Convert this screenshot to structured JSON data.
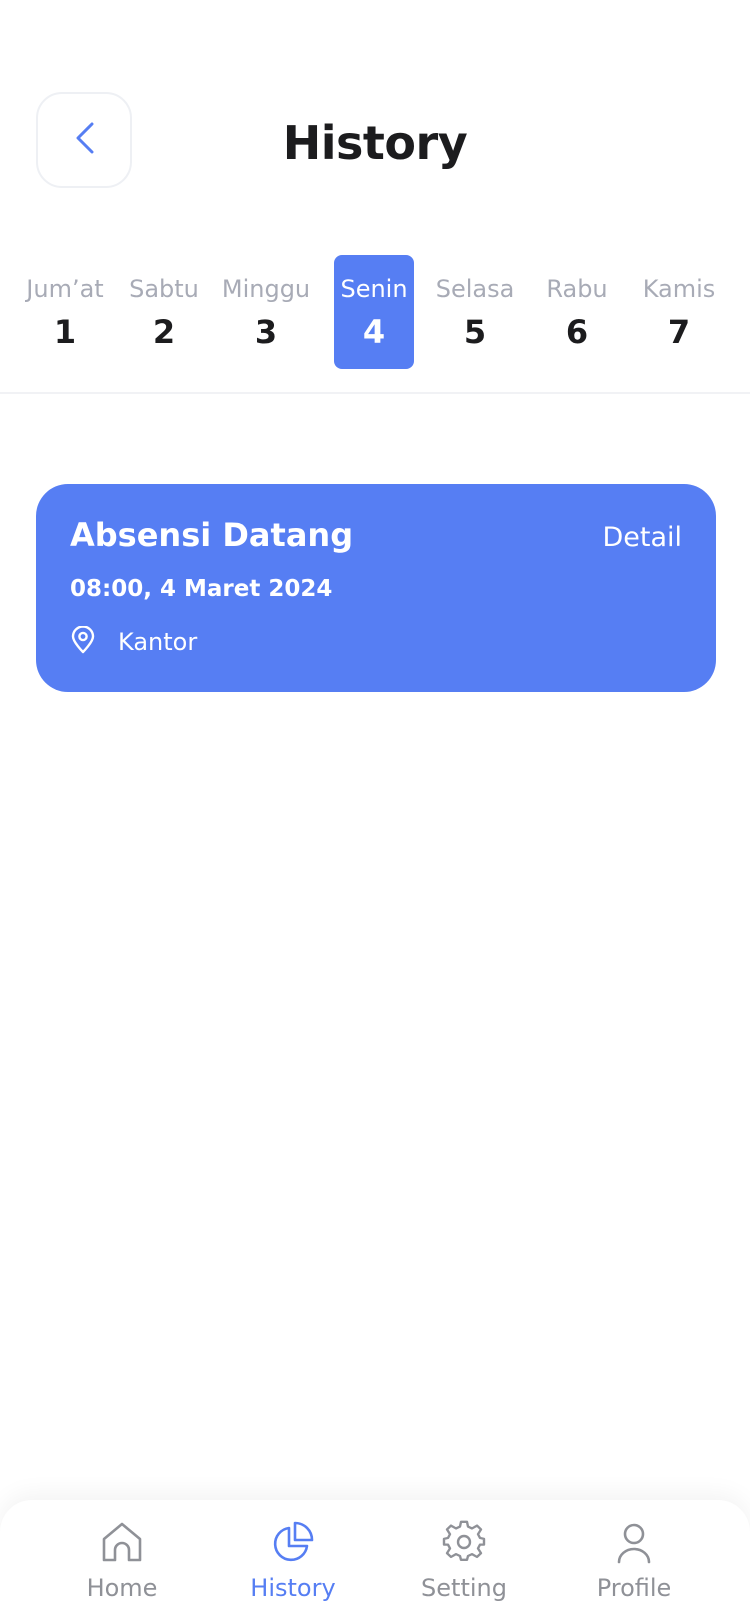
{
  "header": {
    "title": "History",
    "back_icon": "chevron-left-icon"
  },
  "days": [
    {
      "name": "Jum’at",
      "num": "1",
      "active": false
    },
    {
      "name": "Sabtu",
      "num": "2",
      "active": false
    },
    {
      "name": "Minggu",
      "num": "3",
      "active": false
    },
    {
      "name": "Senin",
      "num": "4",
      "active": true
    },
    {
      "name": "Selasa",
      "num": "5",
      "active": false
    },
    {
      "name": "Rabu",
      "num": "6",
      "active": false
    },
    {
      "name": "Kamis",
      "num": "7",
      "active": false
    }
  ],
  "history_card": {
    "title": "Absensi Datang",
    "detail_label": "Detail",
    "datetime": "08:00, 4 Maret 2024",
    "location": "Kantor",
    "location_icon": "map-pin-icon"
  },
  "bottom_nav": {
    "items": [
      {
        "label": "Home",
        "icon": "home-icon",
        "active": false
      },
      {
        "label": "History",
        "icon": "pie-chart-icon",
        "active": true
      },
      {
        "label": "Setting",
        "icon": "gear-icon",
        "active": false
      },
      {
        "label": "Profile",
        "icon": "user-icon",
        "active": false
      }
    ]
  },
  "colors": {
    "accent": "#567ef3",
    "text_dark": "#1c1c1e",
    "text_muted": "#a8abb6",
    "nav_inactive": "#8f9197"
  }
}
